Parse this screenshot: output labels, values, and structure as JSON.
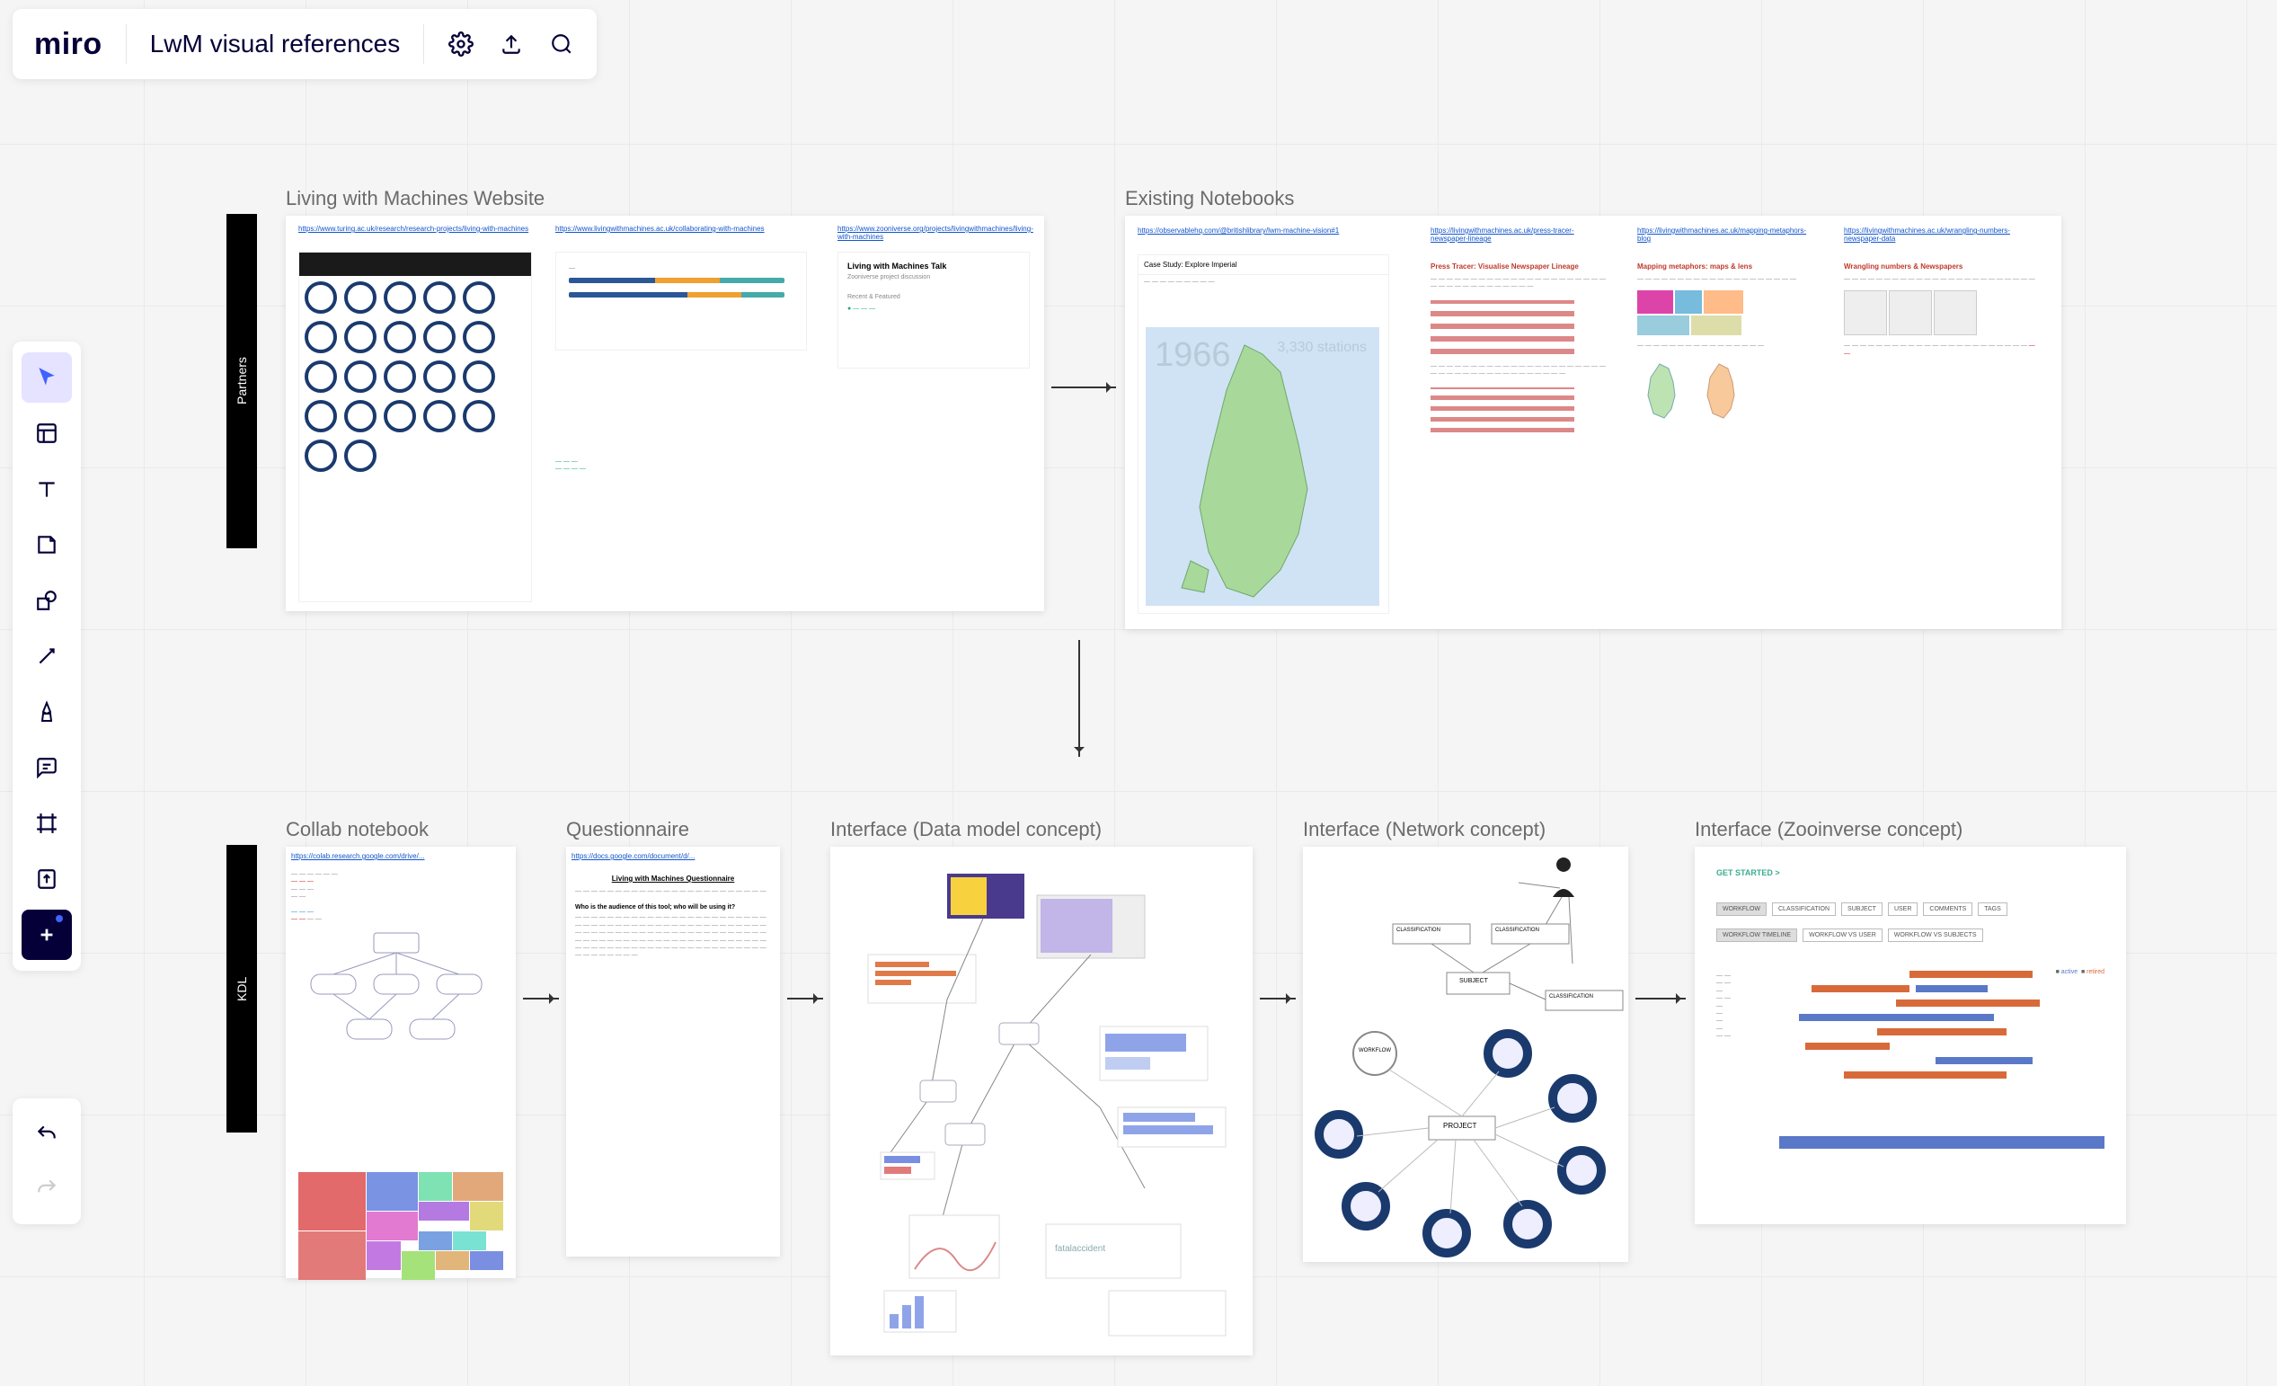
{
  "header": {
    "logo": "miro",
    "board_name": "LwM visual references"
  },
  "toolbar": {
    "select": "select",
    "templates": "templates",
    "text": "text",
    "sticky": "sticky",
    "shapes": "shapes",
    "line": "line",
    "pen": "pen",
    "comment": "comment",
    "frame": "frame",
    "upload": "upload",
    "more": "more",
    "undo": "undo",
    "redo": "redo"
  },
  "side_labels": {
    "partners": "Partners",
    "kdl": "KDL"
  },
  "frames": {
    "website": "Living with Machines Website",
    "notebooks": "Existing Notebooks",
    "collab": "Collab notebook",
    "questionnaire": "Questionnaire",
    "interface_data": "Interface (Data model concept)",
    "interface_network": "Interface (Network concept)",
    "interface_zoo": "Interface (Zooinverse concept)"
  },
  "website": {
    "link1": "https://www.turing.ac.uk/research/research-projects/living-with-machines",
    "link2": "https://www.livingwithmachines.ac.uk/collaborating-with-machines",
    "link3": "https://www.zooniverse.org/projects/livingwithmachines/living-with-machines",
    "talk_title": "Living with Machines Talk",
    "talk_sub1": "Zooniverse project discussion",
    "talk_sub2": "Recent & Featured"
  },
  "notebooks": {
    "link1": "https://observablehq.com/@britishlibrary/lwm-machine-vision#1",
    "link2": "https://livingwithmachines.ac.uk/press-tracer-newspaper-lineage",
    "link3": "https://livingwithmachines.ac.uk/mapping-metaphors-blog",
    "link4": "https://livingwithmachines.ac.uk/wrangling-numbers-newspaper-data",
    "case_study": "Case Study: Explore Imperial",
    "map_year": "1966",
    "map_stations": "3,330 stations",
    "t2": "Press Tracer: Visualise Newspaper Lineage",
    "t3": "Mapping metaphors: maps & lens",
    "t4": "Wrangling numbers & Newspapers"
  },
  "collab": {
    "link": "https://colab.research.google.com/drive/..."
  },
  "questionnaire": {
    "link": "https://docs.google.com/document/d/...",
    "title": "Living with Machines Questionnaire",
    "q1": "Who is the audience of this tool; who will be using it?"
  },
  "interface_data": {},
  "interface_network": {
    "classification": "CLASSIFICATION",
    "subject": "SUBJECT",
    "workflow": "WORKFLOW",
    "project": "PROJECT"
  },
  "zooinverse": {
    "get_started": "GET STARTED >",
    "buttons": [
      "WORKFLOW",
      "CLASSIFICATION",
      "SUBJECT",
      "USER",
      "COMMENTS",
      "TAGS"
    ],
    "buttons2": [
      "WORKFLOW TIMELINE",
      "WORKFLOW VS USER",
      "WORKFLOW VS SUBJECTS"
    ]
  }
}
